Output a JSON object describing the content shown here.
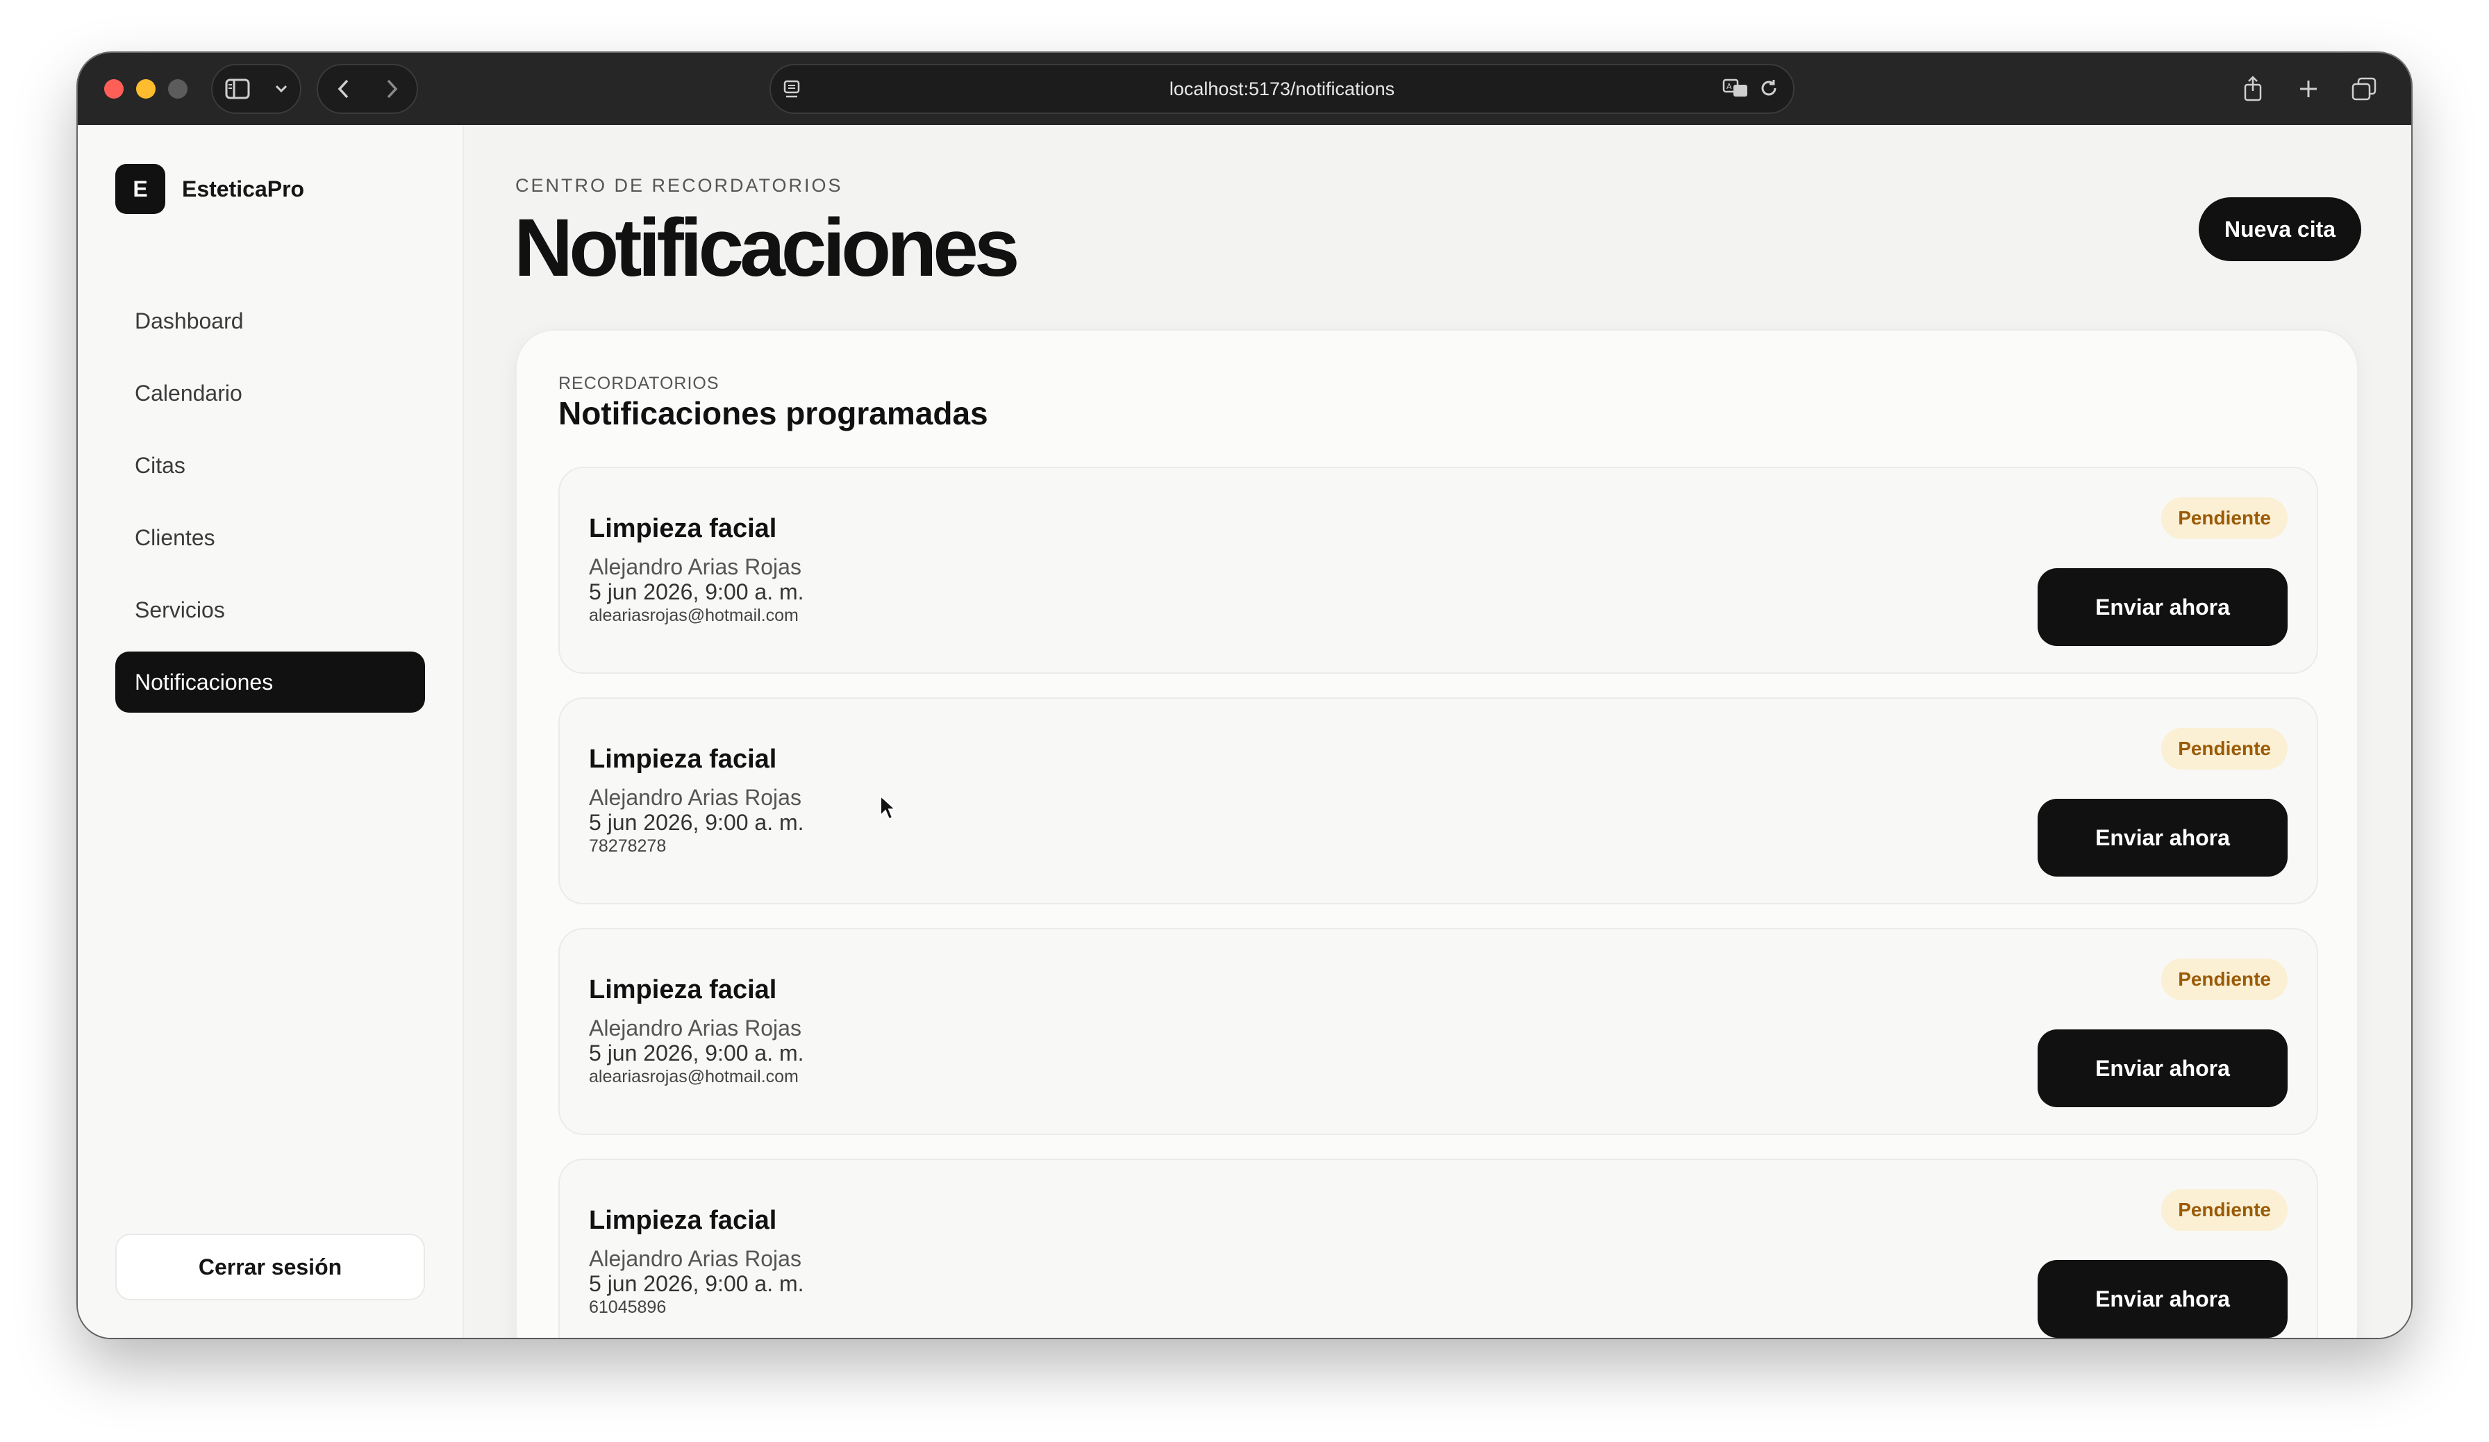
{
  "browser": {
    "url": "localhost:5173/notifications"
  },
  "sidebar": {
    "brand_logo_letter": "E",
    "brand_name": "EsteticaPro",
    "items": [
      {
        "label": "Dashboard"
      },
      {
        "label": "Calendario"
      },
      {
        "label": "Citas"
      },
      {
        "label": "Clientes"
      },
      {
        "label": "Servicios"
      },
      {
        "label": "Notificaciones",
        "active": true
      }
    ],
    "logout_label": "Cerrar sesión"
  },
  "header": {
    "eyebrow": "CENTRO DE RECORDATORIOS",
    "title": "Notificaciones",
    "primary_button": "Nueva cita"
  },
  "panel": {
    "eyebrow": "RECORDATORIOS",
    "title": "Notificaciones programadas",
    "cards": [
      {
        "service": "Limpieza facial",
        "client": "Alejandro Arias Rojas",
        "datetime": "5 jun 2026, 9:00 a. m.",
        "contact": "aleariasrojas@hotmail.com",
        "status": "Pendiente",
        "action": "Enviar ahora"
      },
      {
        "service": "Limpieza facial",
        "client": "Alejandro Arias Rojas",
        "datetime": "5 jun 2026, 9:00 a. m.",
        "contact": "78278278",
        "status": "Pendiente",
        "action": "Enviar ahora"
      },
      {
        "service": "Limpieza facial",
        "client": "Alejandro Arias Rojas",
        "datetime": "5 jun 2026, 9:00 a. m.",
        "contact": "aleariasrojas@hotmail.com",
        "status": "Pendiente",
        "action": "Enviar ahora"
      },
      {
        "service": "Limpieza facial",
        "client": "Alejandro Arias Rojas",
        "datetime": "5 jun 2026, 9:00 a. m.",
        "contact": "61045896",
        "status": "Pendiente",
        "action": "Enviar ahora"
      }
    ]
  },
  "colors": {
    "accent": "#111111",
    "badge_bg": "#fbefd4",
    "badge_text": "#9a5b06"
  }
}
